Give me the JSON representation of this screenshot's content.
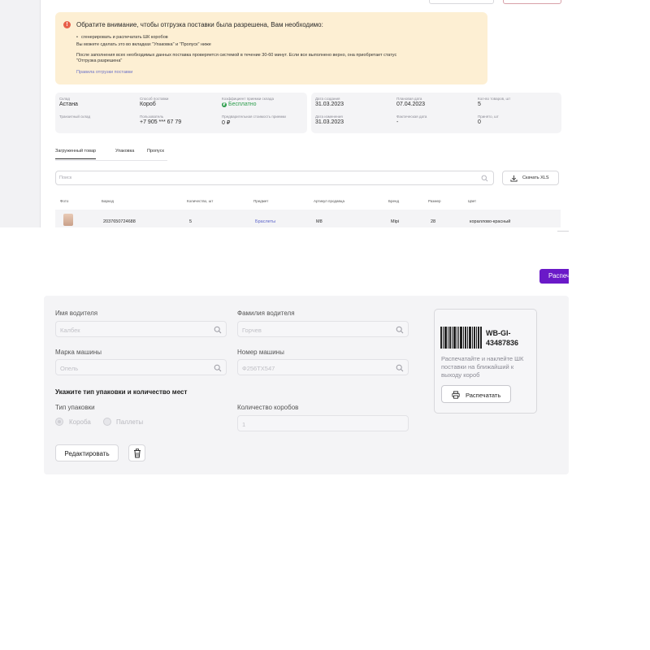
{
  "alert": {
    "title": "Обратите внимание, чтобы отгрузка поставки была разрешена, Вам необходимо:",
    "bullet": "сгенерировать и распечатать ШК коробов",
    "line1": "Вы можете сделать это во вкладках \"Упаковка\" и \"Пропуск\" ниже",
    "line2": "После заполнения всех необходимых данных поставка проверяется системой в течение 30-60 минут. Если все выполнено верно, она приобретает статус",
    "line3": "\"Отгрузка разрешена\"",
    "link": "Правила отгрузки поставки"
  },
  "info_left": {
    "warehouse_label": "Склад",
    "warehouse_value": "Астана",
    "method_label": "Способ поставки",
    "method_value": "Короб",
    "coef_label": "Коэффициент приемки склада",
    "coef_value": "Бесплатно",
    "transit_label": "Транзитный склад",
    "user_label": "Пользователь",
    "user_value": "+7 905 *** 67 79",
    "cost_label": "Предварительная стоимость приемки",
    "cost_value": "0 ₽"
  },
  "info_right": {
    "created_label": "Дата создания",
    "created_value": "31.03.2023",
    "planned_label": "Плановая дата",
    "planned_value": "07.04.2023",
    "qty_label": "Кол-во товаров, шт",
    "qty_value": "5",
    "changed_label": "Дата изменения",
    "changed_value": "31.03.2023",
    "fact_label": "Фактическая дата",
    "fact_value": "-",
    "accepted_label": "Принято, шт",
    "accepted_value": "0"
  },
  "tabs": [
    "Загруженный товар",
    "Упаковка",
    "Пропуск"
  ],
  "search": {
    "placeholder": "Поиск"
  },
  "export_label": "Скачать XLS",
  "table": {
    "headers": [
      "Фото",
      "Баркод",
      "Количество, шт",
      "Предмет",
      "Артикул продавца",
      "Бренд",
      "Размер",
      "Цвет"
    ],
    "rows": [
      {
        "barcode": "2037650724688",
        "qty": "5",
        "subject": "Браслеты",
        "article": "M8",
        "brand": "Mipi",
        "size": "28",
        "color": "кораллово-красный"
      }
    ]
  },
  "print_top_label": "Распечатать",
  "form": {
    "driver_name_label": "Имя водителя",
    "driver_name_placeholder": "Калбек",
    "driver_surname_label": "Фамилия водителя",
    "driver_surname_placeholder": "Горчев",
    "car_brand_label": "Марка машины",
    "car_brand_placeholder": "Опель",
    "car_number_label": "Номер машины",
    "car_number_placeholder": "Ф256ТХ547",
    "section_title": "Укажите тип упаковки и количество мест",
    "pack_type_label": "Тип упаковки",
    "pack_options": [
      "Короба",
      "Паллеты"
    ],
    "box_count_label": "Количество коробов",
    "box_count_value": "1",
    "edit_label": "Редактировать"
  },
  "barcode_card": {
    "id": "WB-GI-43487836",
    "note": "Распечатайте и наклейте ШК поставки на ближайший к выходу короб",
    "print_label": "Распечатать"
  }
}
